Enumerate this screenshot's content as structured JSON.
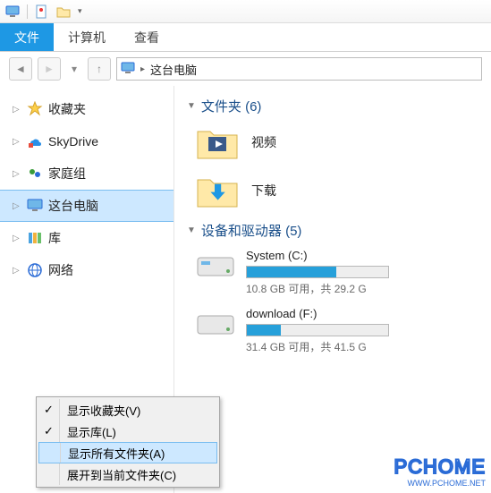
{
  "ribbon": {
    "tabs": [
      "文件",
      "计算机",
      "查看"
    ],
    "active": 0
  },
  "address": {
    "crumb": "这台电脑"
  },
  "sidebar": {
    "items": [
      {
        "label": "收藏夹",
        "icon": "star"
      },
      {
        "label": "SkyDrive",
        "icon": "skydrive"
      },
      {
        "label": "家庭组",
        "icon": "homegroup"
      },
      {
        "label": "这台电脑",
        "icon": "pc",
        "selected": true
      },
      {
        "label": "库",
        "icon": "libraries"
      },
      {
        "label": "网络",
        "icon": "network"
      }
    ]
  },
  "main": {
    "folders_header": "文件夹 (6)",
    "folders": [
      {
        "label": "视频",
        "icon": "video-folder"
      },
      {
        "label": "下载",
        "icon": "download-folder"
      }
    ],
    "drives_header": "设备和驱动器 (5)",
    "drives": [
      {
        "name": "System (C:)",
        "free_text": "10.8 GB 可用，共 29.2 G",
        "fill_pct": 63
      },
      {
        "name": "download (F:)",
        "free_text": "31.4 GB 可用，共 41.5 G",
        "fill_pct": 24
      }
    ]
  },
  "context_menu": {
    "items": [
      {
        "label": "显示收藏夹(V)",
        "checked": true
      },
      {
        "label": "显示库(L)",
        "checked": true
      },
      {
        "label": "显示所有文件夹(A)",
        "checked": false,
        "hover": true
      },
      {
        "label": "展开到当前文件夹(C)",
        "checked": false
      }
    ]
  },
  "watermark": {
    "main": "PCHOME",
    "sub": "WWW.PCHOME.NET"
  }
}
